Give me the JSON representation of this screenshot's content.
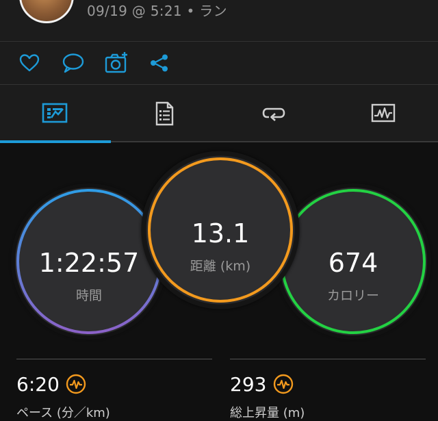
{
  "activity": {
    "subtitle": "09/19 @ 5:21 • ラン"
  },
  "actions": [
    {
      "name": "like-heart-icon"
    },
    {
      "name": "comment-bubble-icon"
    },
    {
      "name": "add-photo-icon"
    },
    {
      "name": "share-icon"
    }
  ],
  "tabs": [
    {
      "name": "overview-tab",
      "active": true
    },
    {
      "name": "stats-tab",
      "active": false
    },
    {
      "name": "laps-tab",
      "active": false
    },
    {
      "name": "charts-tab",
      "active": false
    }
  ],
  "summary": {
    "time": {
      "value": "1:22:57",
      "label": "時間"
    },
    "distance": {
      "value": "13.1",
      "label": "距離 (km)"
    },
    "calories": {
      "value": "674",
      "label": "カロリー"
    }
  },
  "stats": {
    "pace": {
      "value": "6:20",
      "label": "ペース (分／km)"
    },
    "elevation": {
      "value": "293",
      "label": "総上昇量 (m)"
    }
  },
  "colors": {
    "accent": "#1d9bd8",
    "time_ring_start": "#2f9de6",
    "time_ring_end": "#8b62c8",
    "distance_ring": "#f39a1e",
    "calories_ring": "#23d143",
    "badge": "#f39a1e"
  }
}
